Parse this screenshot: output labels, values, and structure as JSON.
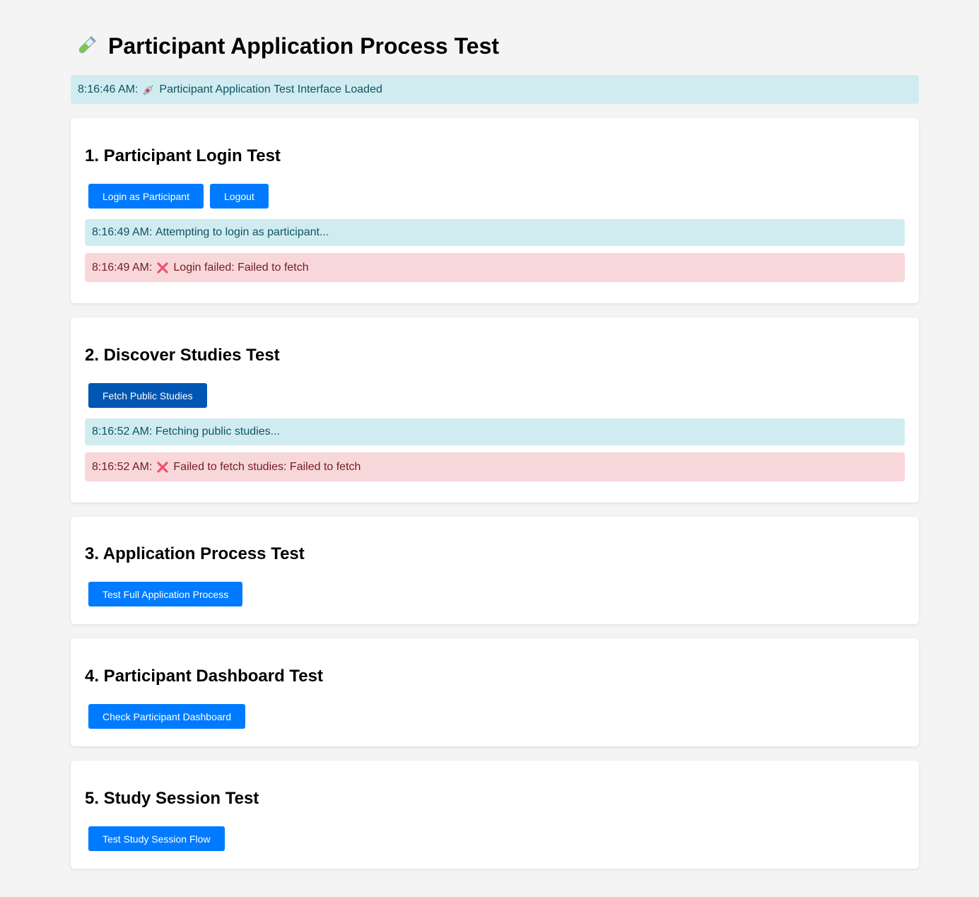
{
  "page": {
    "title": "Participant Application Process Test",
    "title_icon": "test-tube-icon",
    "status": {
      "time": "8:16:46 AM:",
      "icon": "syringe-icon",
      "text": "Participant Application Test Interface Loaded"
    }
  },
  "sections": {
    "login": {
      "heading": "1. Participant Login Test",
      "buttons": {
        "login": "Login as Participant",
        "logout": "Logout"
      },
      "log": [
        {
          "type": "info",
          "time": "8:16:49 AM:",
          "text": "Attempting to login as participant..."
        },
        {
          "type": "error",
          "time": "8:16:49 AM:",
          "icon": "cross-mark-icon",
          "text": "Login failed: Failed to fetch"
        }
      ]
    },
    "discover": {
      "heading": "2. Discover Studies Test",
      "buttons": {
        "fetch": "Fetch Public Studies"
      },
      "log": [
        {
          "type": "info",
          "time": "8:16:52 AM:",
          "text": "Fetching public studies..."
        },
        {
          "type": "error",
          "time": "8:16:52 AM:",
          "icon": "cross-mark-icon",
          "text": "Failed to fetch studies: Failed to fetch"
        }
      ]
    },
    "application": {
      "heading": "3. Application Process Test",
      "buttons": {
        "test": "Test Full Application Process"
      }
    },
    "dashboard": {
      "heading": "4. Participant Dashboard Test",
      "buttons": {
        "check": "Check Participant Dashboard"
      }
    },
    "session": {
      "heading": "5. Study Session Test",
      "buttons": {
        "test": "Test Study Session Flow"
      }
    }
  },
  "colors": {
    "primary_button": "#007bff",
    "active_button": "#0056b3",
    "info_bg": "#d1ecf1",
    "info_text": "#0c5460",
    "error_bg": "#f8d7da",
    "error_text": "#721c24",
    "page_bg": "#f4f4f4"
  }
}
